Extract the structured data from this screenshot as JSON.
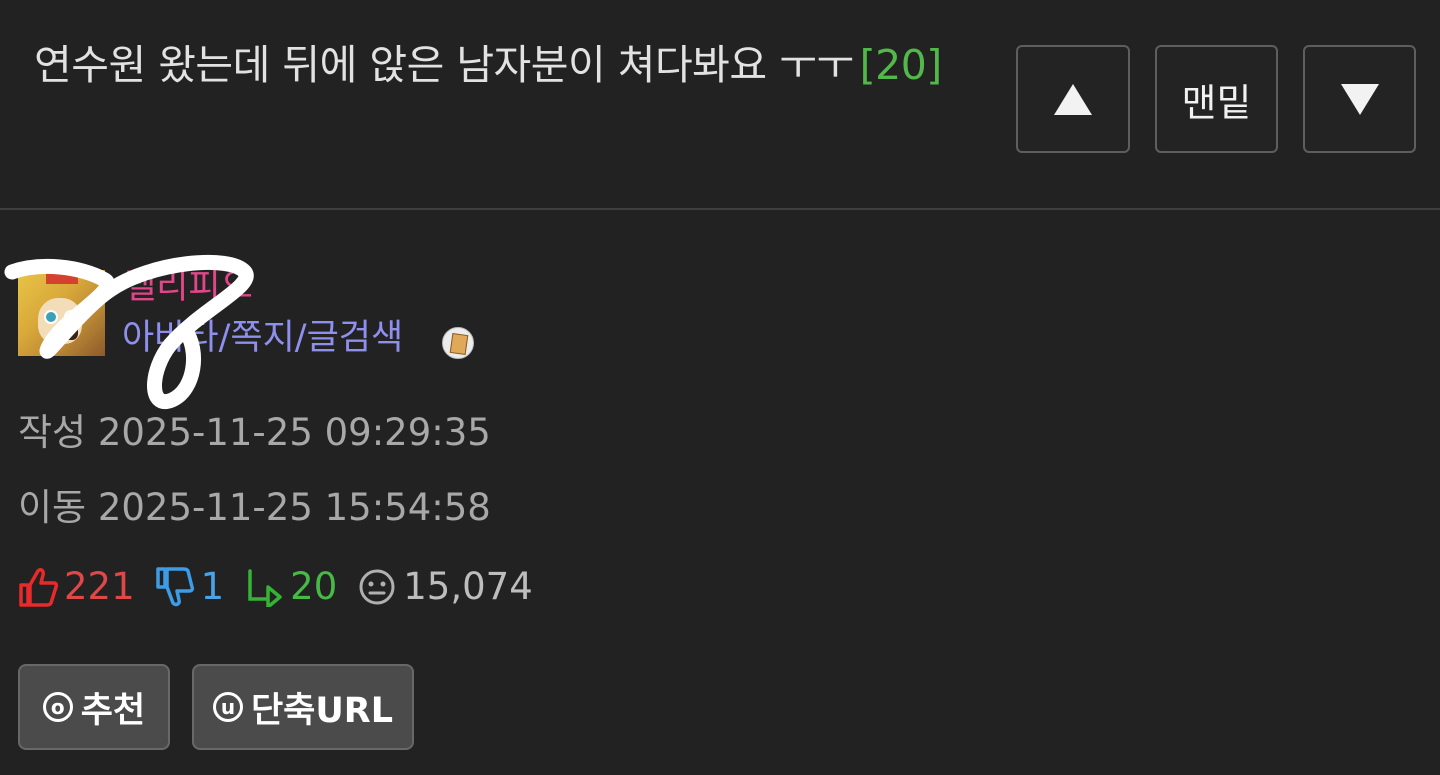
{
  "post": {
    "title": "연수원 왔는데 뒤에 앉은 남자분이 쳐다봐요 ㅜㅜ",
    "comment_count": "[20]"
  },
  "nav": {
    "up_icon": "triangle-up-icon",
    "bottom_label": "맨밑",
    "down_icon": "triangle-down-icon"
  },
  "author": {
    "nickname": "델리피오",
    "links": "아바타/쪽지/글검색",
    "level_icon": "level-badge-icon"
  },
  "meta": {
    "created": "작성 2025-11-25 09:29:35",
    "moved": "이동 2025-11-25 15:54:58"
  },
  "stats": {
    "upvotes": "221",
    "downvotes": "1",
    "comments": "20",
    "views": "15,074"
  },
  "actions": {
    "recommend_icon": "ⓞ",
    "recommend_label": "추천",
    "shorturl_icon": "ⓤ",
    "shorturl_label": "단축URL"
  },
  "colors": {
    "background": "#222222",
    "nickname": "#e0478a",
    "links": "#8f8fee",
    "comment_count": "#52b84a",
    "upvote": "#e04848",
    "downvote": "#4aa3e6",
    "reply": "#47b947"
  }
}
